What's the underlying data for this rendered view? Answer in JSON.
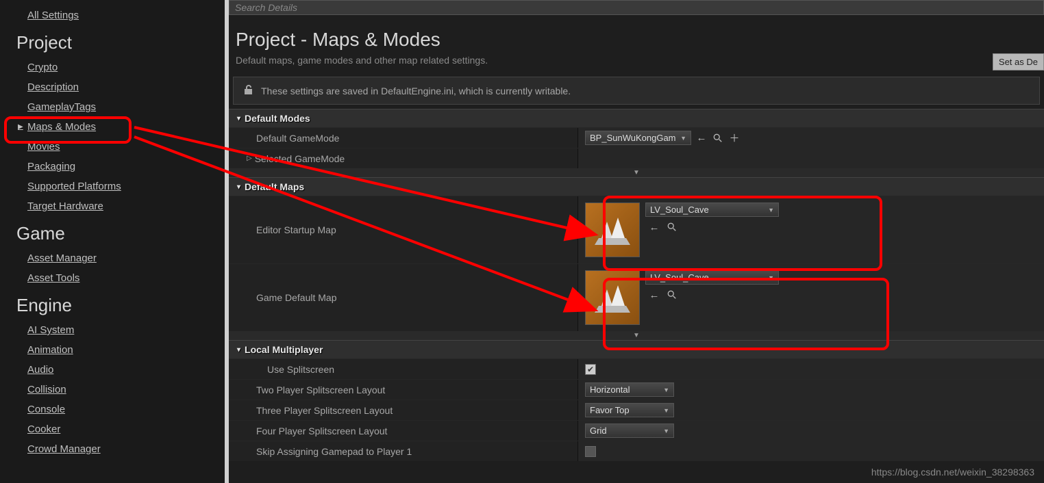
{
  "sidebar": {
    "all_settings": "All Settings",
    "sections": [
      {
        "title": "Project",
        "items": [
          "Crypto",
          "Description",
          "GameplayTags",
          "Maps & Modes",
          "Movies",
          "Packaging",
          "Supported Platforms",
          "Target Hardware"
        ],
        "active_index": 3
      },
      {
        "title": "Game",
        "items": [
          "Asset Manager",
          "Asset Tools"
        ]
      },
      {
        "title": "Engine",
        "items": [
          "AI System",
          "Animation",
          "Audio",
          "Collision",
          "Console",
          "Cooker",
          "Crowd Manager"
        ]
      }
    ]
  },
  "search_placeholder": "Search Details",
  "page_title": "Project - Maps & Modes",
  "page_subtitle": "Default maps, game modes and other map related settings.",
  "set_default_btn": "Set as De",
  "notice_text": "These settings are saved in DefaultEngine.ini, which is currently writable.",
  "categories": {
    "default_modes": {
      "title": "Default Modes",
      "default_gamemode_label": "Default GameMode",
      "default_gamemode_value": "BP_SunWuKongGam",
      "selected_gamemode_label": "Selected GameMode"
    },
    "default_maps": {
      "title": "Default Maps",
      "editor_startup_label": "Editor Startup Map",
      "editor_startup_value": "LV_Soul_Cave",
      "game_default_label": "Game Default Map",
      "game_default_value": "LV_Soul_Cave"
    },
    "local_multiplayer": {
      "title": "Local Multiplayer",
      "use_splitscreen_label": "Use Splitscreen",
      "use_splitscreen_checked": true,
      "two_player_label": "Two Player Splitscreen Layout",
      "two_player_value": "Horizontal",
      "three_player_label": "Three Player Splitscreen Layout",
      "three_player_value": "Favor Top",
      "four_player_label": "Four Player Splitscreen Layout",
      "four_player_value": "Grid",
      "skip_gamepad_label": "Skip Assigning Gamepad to Player 1"
    }
  },
  "watermark": "https://blog.csdn.net/weixin_38298363"
}
